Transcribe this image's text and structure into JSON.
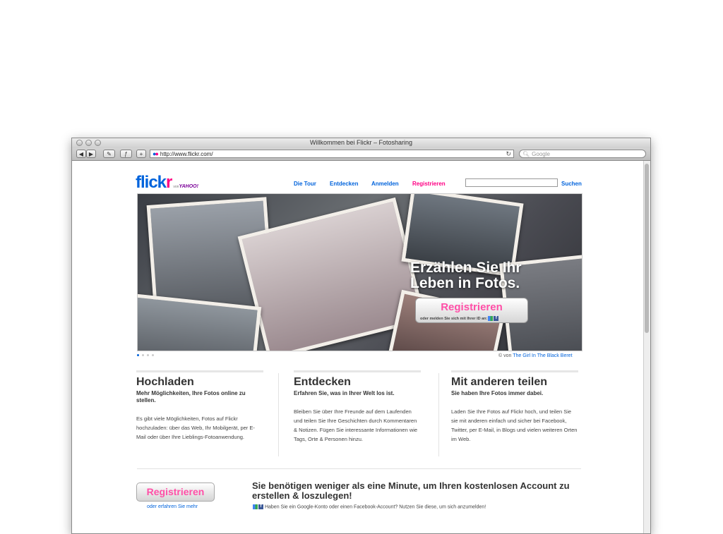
{
  "window": {
    "title": "Willkommen bei Flickr – Fotosharing"
  },
  "toolbar": {
    "back_icon": "back-arrow-icon",
    "forward_icon": "forward-arrow-icon",
    "url": "http://www.flickr.com/",
    "search_placeholder": "Google"
  },
  "header": {
    "logo_text_a": "flick",
    "logo_text_b": "r",
    "logo_von": "von",
    "logo_yahoo": "YAHOO!",
    "nav": [
      "Die Tour",
      "Entdecken",
      "Anmelden",
      "Registrieren"
    ],
    "search_button": "Suchen"
  },
  "hero": {
    "title_line1": "Erzählen Sie Ihr",
    "title_line2": "Leben in Fotos.",
    "button": "Registrieren",
    "sub": "oder melden Sie sich mit Ihrer ID an:",
    "credit_prefix": "© von",
    "credit_name": "The Girl In The Black Beret"
  },
  "columns": [
    {
      "title": "Hochladen",
      "lead": "Mehr Möglichkeiten, Ihre Fotos online zu stellen.",
      "body": "Es gibt viele Möglichkeiten, Fotos auf Flickr hochzuladen: über das Web, Ihr Mobilgerät, per E-Mail oder über Ihre Lieblings-Fotoanwendung."
    },
    {
      "title": "Entdecken",
      "lead": "Erfahren Sie, was in Ihrer Welt los ist.",
      "body": "Bleiben Sie über Ihre Freunde auf dem Laufenden und teilen Sie Ihre Geschichten durch Kommentaren & Notizen. Fügen Sie interessante Informationen wie Tags, Orte & Personen hinzu."
    },
    {
      "title": "Mit anderen teilen",
      "lead": "Sie haben Ihre Fotos immer dabei.",
      "body": "Laden Sie Ihre Fotos auf Flickr hoch, und teilen Sie sie mit anderen einfach und sicher bei Facebook, Twitter, per E-Mail, in Blogs und vielen weiteren Orten im Web."
    }
  ],
  "bottom": {
    "button": "Registrieren",
    "link": "oder erfahren Sie mehr",
    "headline": "Sie benötigen weniger als eine Minute, um Ihren kostenlosen Account zu erstellen & loszulegen!",
    "small": "Haben Sie ein Google-Konto oder einen Facebook-Account? Nutzen Sie diese, um sich anzumelden!"
  },
  "colors": {
    "flickr_blue": "#0063dc",
    "flickr_pink": "#ff0084"
  }
}
